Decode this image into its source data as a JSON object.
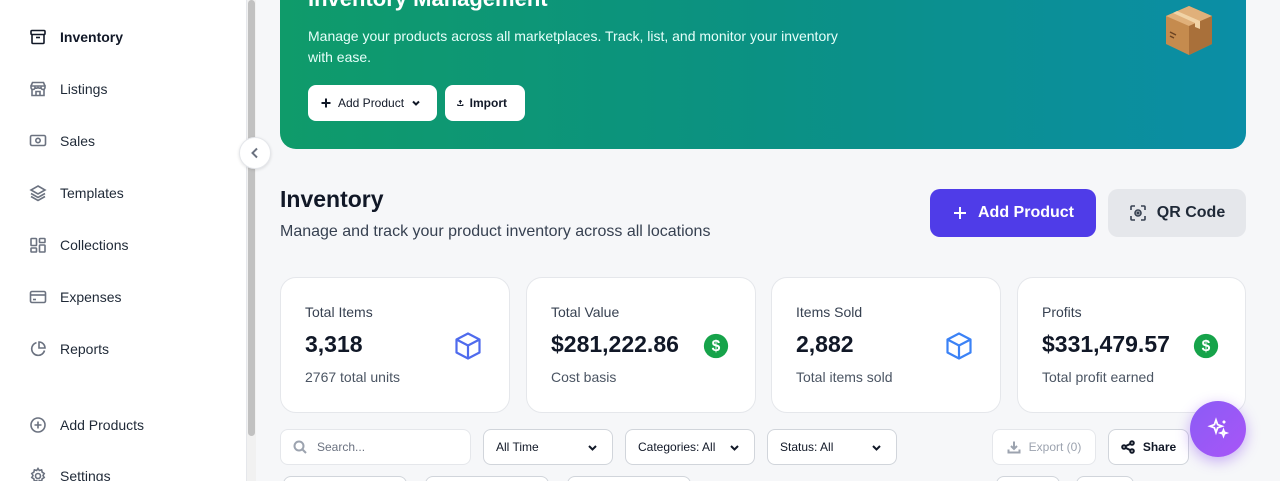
{
  "sidebar": {
    "items": [
      {
        "label": "Inventory",
        "icon": "archive-icon",
        "active": true
      },
      {
        "label": "Listings",
        "icon": "store-icon"
      },
      {
        "label": "Sales",
        "icon": "banknote-icon"
      },
      {
        "label": "Templates",
        "icon": "layers-icon"
      },
      {
        "label": "Collections",
        "icon": "collections-icon"
      },
      {
        "label": "Expenses",
        "icon": "credit-card-icon"
      },
      {
        "label": "Reports",
        "icon": "pie-chart-icon"
      },
      {
        "label": "Add Products",
        "icon": "plus-circle-icon"
      },
      {
        "label": "Settings",
        "icon": "gear-icon"
      }
    ]
  },
  "banner": {
    "title": "Inventory Management",
    "description": "Manage your products across all marketplaces. Track, list, and monitor your inventory with ease.",
    "add_product_label": "Add Product",
    "import_label": "Import",
    "emoji": "📦"
  },
  "header": {
    "title": "Inventory",
    "subtitle": "Manage and track your product inventory across all locations",
    "add_product_label": "Add Product",
    "qr_code_label": "QR Code"
  },
  "stats": [
    {
      "label": "Total Items",
      "value": "3,318",
      "sub": "2767 total units",
      "icon": "box-icon",
      "icon_color": "#4f6bed"
    },
    {
      "label": "Total Value",
      "value": "$281,222.86",
      "sub": "Cost basis",
      "icon": "dollar-icon",
      "icon_color": "#16a34a"
    },
    {
      "label": "Items Sold",
      "value": "2,882",
      "sub": "Total items sold",
      "icon": "box-icon",
      "icon_color": "#3b82f6"
    },
    {
      "label": "Profits",
      "value": "$331,479.57",
      "sub": "Total profit earned",
      "icon": "dollar-icon",
      "icon_color": "#16a34a"
    }
  ],
  "filters": {
    "search_placeholder": "Search...",
    "time": "All Time",
    "categories": "Categories: All",
    "status": "Status: All",
    "export_label": "Export (0)",
    "share_label": "Share"
  },
  "colors": {
    "primary": "#4f3ce8",
    "banner_start": "#0f9b6a",
    "banner_end": "#0b8ea6",
    "fab": "#8b5cf6"
  }
}
